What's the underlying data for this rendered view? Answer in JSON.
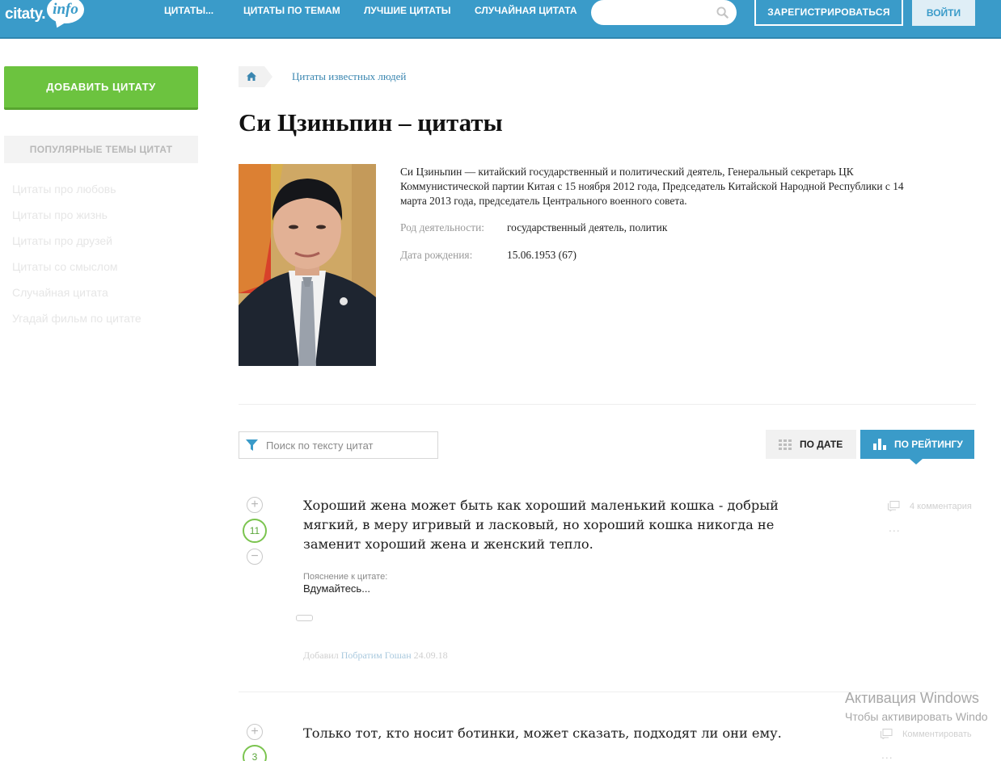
{
  "header": {
    "logo_main": "citaty.",
    "logo_bubble": "info",
    "nav": [
      "ЦИТАТЫ...",
      "ЦИТАТЫ ПО ТЕМАМ",
      "ЛУЧШИЕ ЦИТАТЫ",
      "СЛУЧАЙНАЯ ЦИТАТА"
    ],
    "search_placeholder": "",
    "register_label": "ЗАРЕГИСТРИРОВАТЬСЯ",
    "login_label": "ВОЙТИ",
    "brand_color": "#3a9bc9"
  },
  "sidebar": {
    "add_quote_label": "ДОБАВИТЬ ЦИТАТУ",
    "popular_title": "ПОПУЛЯРНЫЕ ТЕМЫ ЦИТАТ",
    "links": [
      "Цитаты про любовь",
      "Цитаты про жизнь",
      "Цитаты про друзей",
      "Цитаты со смыслом",
      "Случайная цитата",
      "Угадай фильм по цитате"
    ]
  },
  "breadcrumb": {
    "home_icon": "home-icon",
    "link": "Цитаты известных людей"
  },
  "page": {
    "title": "Си Цзиньпин – цитаты",
    "description": "Си Цзиньпин — китайский государственный и политический деятель, Генеральный секретарь ЦК Коммунистической партии Китая с 15 ноября 2012 года, Председатель Китайской Народной Республики с 14 марта 2013 года, председатель Центрального военного совета.",
    "occupation_label": "Род деятельности:",
    "occupation_value": "государственный деятель, политик",
    "birth_label": "Дата рождения:",
    "birth_value": "15.06.1953 (67)"
  },
  "filter": {
    "placeholder": "Поиск по тексту цитат",
    "sort_date": "ПО ДАТЕ",
    "sort_rating": "ПО РЕЙТИНГУ"
  },
  "quotes": [
    {
      "plus": "+",
      "score": "11",
      "minus": "−",
      "text": "Хороший жена может быть как хороший маленький кошка - добрый мягкий, в меру игривый и ласковый, но хороший кошка никогда не заменит хороший жена и женский тепло.",
      "explanation_label": "Пояснение к цитате:",
      "explanation": "Вдумайтесь...",
      "added_prefix": "Добавил",
      "author": "Побратим Гошан",
      "date": "24.09.18",
      "comments": "4 комментария",
      "more": "..."
    },
    {
      "plus": "+",
      "score": "3",
      "text": "Только тот, кто носит ботинки, может сказать, подходят ли они ему.",
      "comments": "Комментировать",
      "more": "..."
    }
  ],
  "watermark": {
    "line1": "Активация Windows",
    "line2": "Чтобы активировать Windo"
  }
}
